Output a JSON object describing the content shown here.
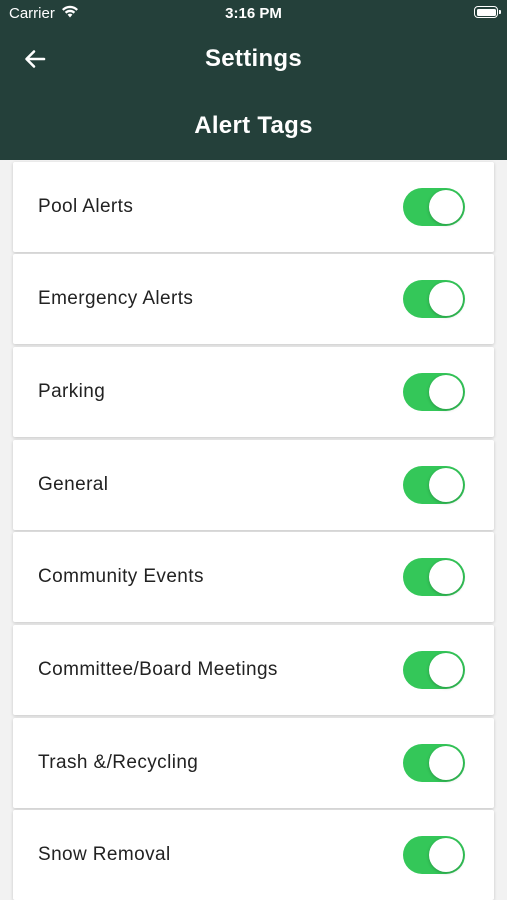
{
  "status_bar": {
    "carrier": "Carrier",
    "time": "3:16 PM"
  },
  "nav": {
    "title": "Settings",
    "back_icon": "arrow-left-icon"
  },
  "section_title": "Alert Tags",
  "colors": {
    "header_bg": "#24403a",
    "toggle_on": "#34c759"
  },
  "alert_tags": [
    {
      "label": "Pool Alerts",
      "enabled": true
    },
    {
      "label": "Emergency Alerts",
      "enabled": true
    },
    {
      "label": "Parking",
      "enabled": true
    },
    {
      "label": "General",
      "enabled": true
    },
    {
      "label": "Community Events",
      "enabled": true
    },
    {
      "label": "Committee/Board Meetings",
      "enabled": true
    },
    {
      "label": "Trash &/Recycling",
      "enabled": true
    },
    {
      "label": "Snow Removal",
      "enabled": true
    }
  ]
}
